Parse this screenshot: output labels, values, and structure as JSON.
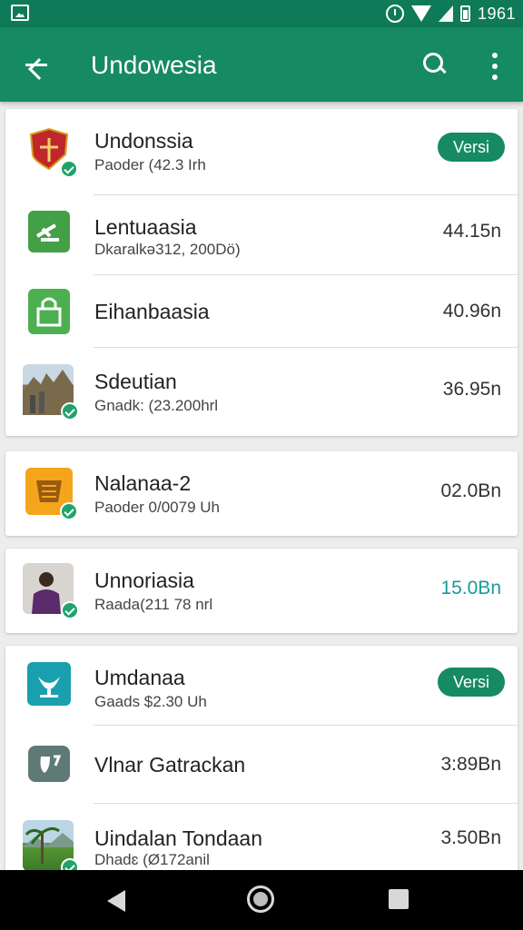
{
  "status_bar": {
    "time": "1961"
  },
  "app_bar": {
    "title": "Undowesia"
  },
  "items": [
    {
      "title": "Undonssia",
      "subtitle": "Paoder (42.3 Irh",
      "action_label": "Versi"
    },
    {
      "title": "Lentuaasia",
      "subtitle": "Dkaralkə312, 200Dö)",
      "value": "44.15n"
    },
    {
      "title": "Eihanbaasia",
      "value": "40.96n"
    },
    {
      "title": "Sdeutian",
      "subtitle": "Gnadk: (23.200hrl",
      "value": "36.95n"
    },
    {
      "title": "Nalanaa-2",
      "subtitle": "Paoder 0/0079 Uh",
      "value": "02.0Bn"
    },
    {
      "title": "Unnoriasia",
      "subtitle": "Raada(211 78 nrl",
      "value": "15.0Bn"
    },
    {
      "title": "Umdanaa",
      "subtitle": "Gaads $2.30 Uh",
      "action_label": "Versi"
    },
    {
      "title": "Vlnar Gatrackan",
      "value": "3:89Bn"
    },
    {
      "title": "Uindalan Tondaan",
      "subtitle": "Dhadɛ (Ø172anil",
      "value": "3.50Bn"
    }
  ],
  "colors": {
    "primary": "#168a62",
    "status_bar": "#0f7a57",
    "accent_value": "#1a9a9a"
  }
}
